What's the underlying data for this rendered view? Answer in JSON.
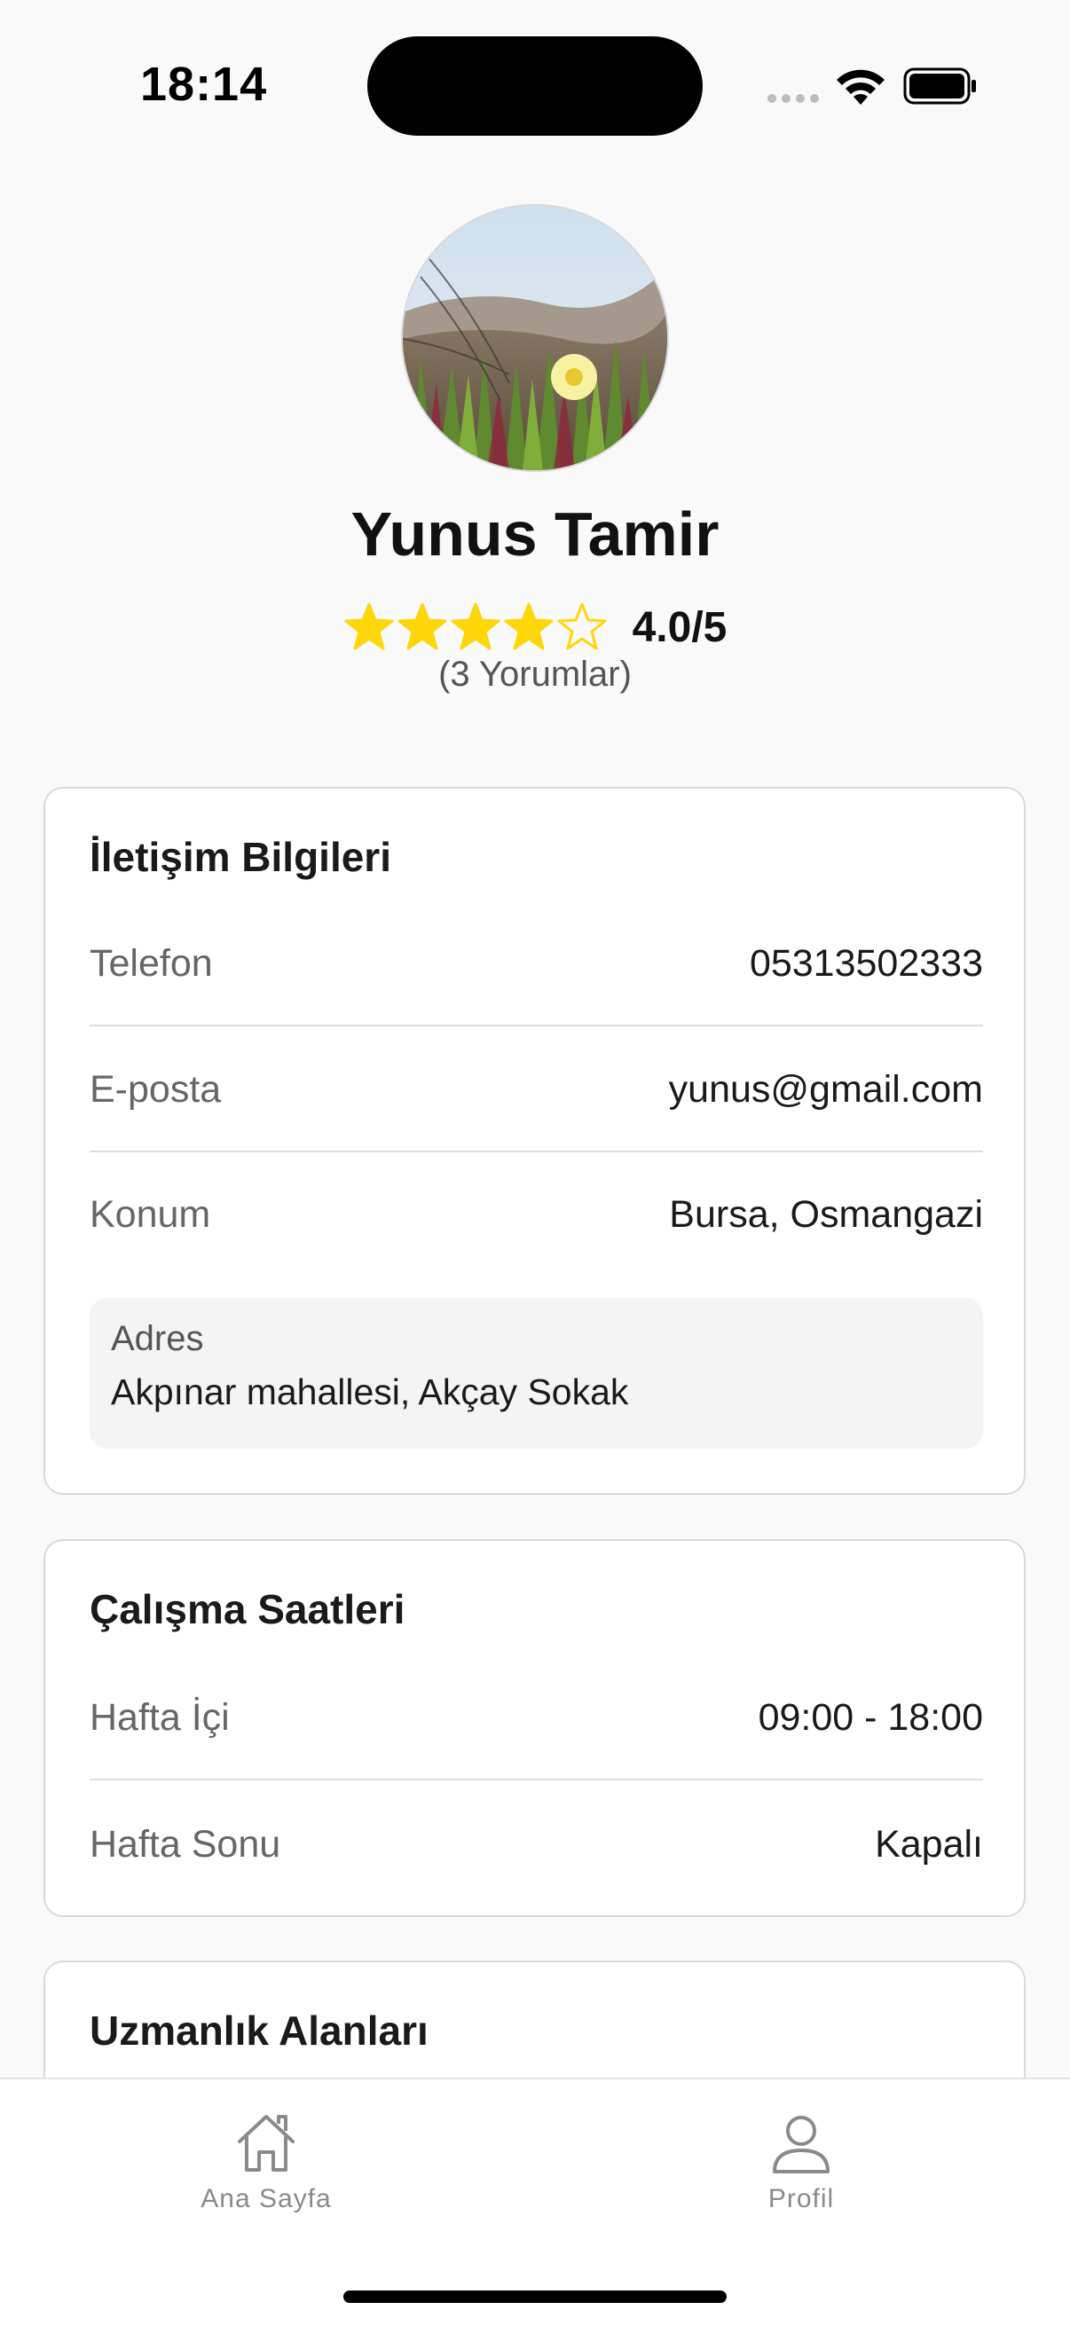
{
  "status_bar": {
    "time": "18:14",
    "icons": [
      "signal-dots-icon",
      "wifi-icon",
      "battery-icon"
    ]
  },
  "profile": {
    "avatar_icon": "flower-photo",
    "name": "Yunus Tamir",
    "rating": 4.0,
    "rating_max": 5,
    "rating_text": "4.0/5",
    "reviews": "(3 Yorumlar)"
  },
  "contact_card": {
    "title": "İletişim Bilgileri",
    "phone_label": "Telefon",
    "phone_value": "05313502333",
    "email_label": "E-posta",
    "email_value": "yunus@gmail.com",
    "location_label": "Konum",
    "location_value": "Bursa, Osmangazi",
    "address_label": "Adres",
    "address_value": "Akpınar mahallesi, Akçay Sokak"
  },
  "hours_card": {
    "title": "Çalışma Saatleri",
    "weekday_label": "Hafta İçi",
    "weekday_value": "09:00 - 18:00",
    "weekend_label": "Hafta Sonu",
    "weekend_value": "Kapalı"
  },
  "expertise_card": {
    "title": "Uzmanlık Alanları"
  },
  "tab_bar": {
    "home_label": "Ana Sayfa",
    "profile_label": "Profil"
  },
  "colors": {
    "star": "#FFD60A",
    "background": "#F9F9F9",
    "card_border": "#D9D9D9",
    "tab_inactive": "#8A8A8A"
  }
}
